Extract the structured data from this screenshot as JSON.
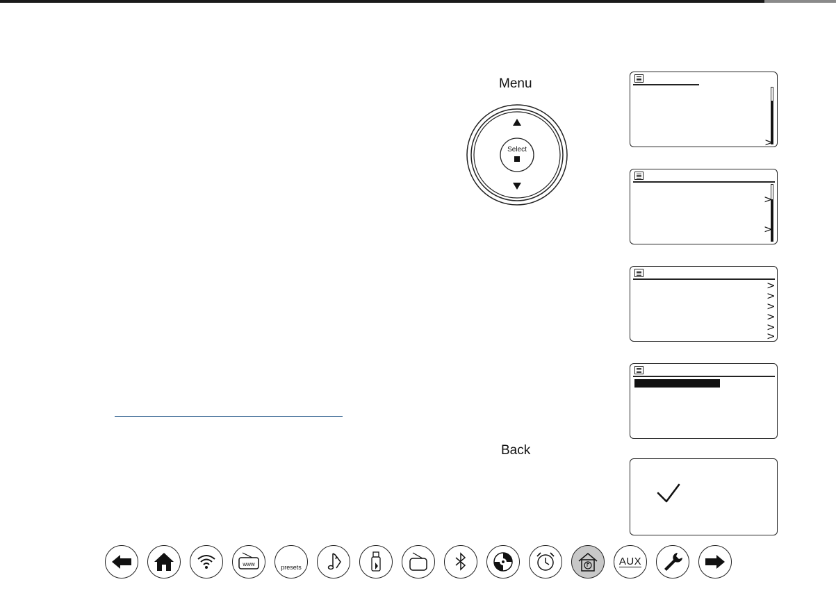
{
  "controls": {
    "menu_label": "Menu",
    "select_label": "Select",
    "back_label": "Back"
  },
  "screens": [
    {
      "name": "screen-1",
      "arrows": [
        ">"
      ]
    },
    {
      "name": "screen-2",
      "arrows": [
        ">",
        ">"
      ]
    },
    {
      "name": "screen-3",
      "arrows": [
        ">",
        ">",
        ">",
        ">",
        ">",
        ">"
      ]
    },
    {
      "name": "screen-4",
      "highlight": true
    },
    {
      "name": "screen-5",
      "check_icon": "check-icon"
    }
  ],
  "nav": {
    "presets_label": "presets",
    "aux_label": "AUX",
    "buttons": [
      "back-arrow-icon",
      "home-icon",
      "wifi-icon",
      "internet-radio-icon",
      "presets-button",
      "music-player-icon",
      "usb-icon",
      "dab-radio-icon",
      "bluetooth-icon",
      "cd-icon",
      "alarm-clock-icon",
      "home-media-icon",
      "aux-button",
      "wrench-icon",
      "forward-arrow-icon"
    ],
    "active": "home-media-icon"
  }
}
